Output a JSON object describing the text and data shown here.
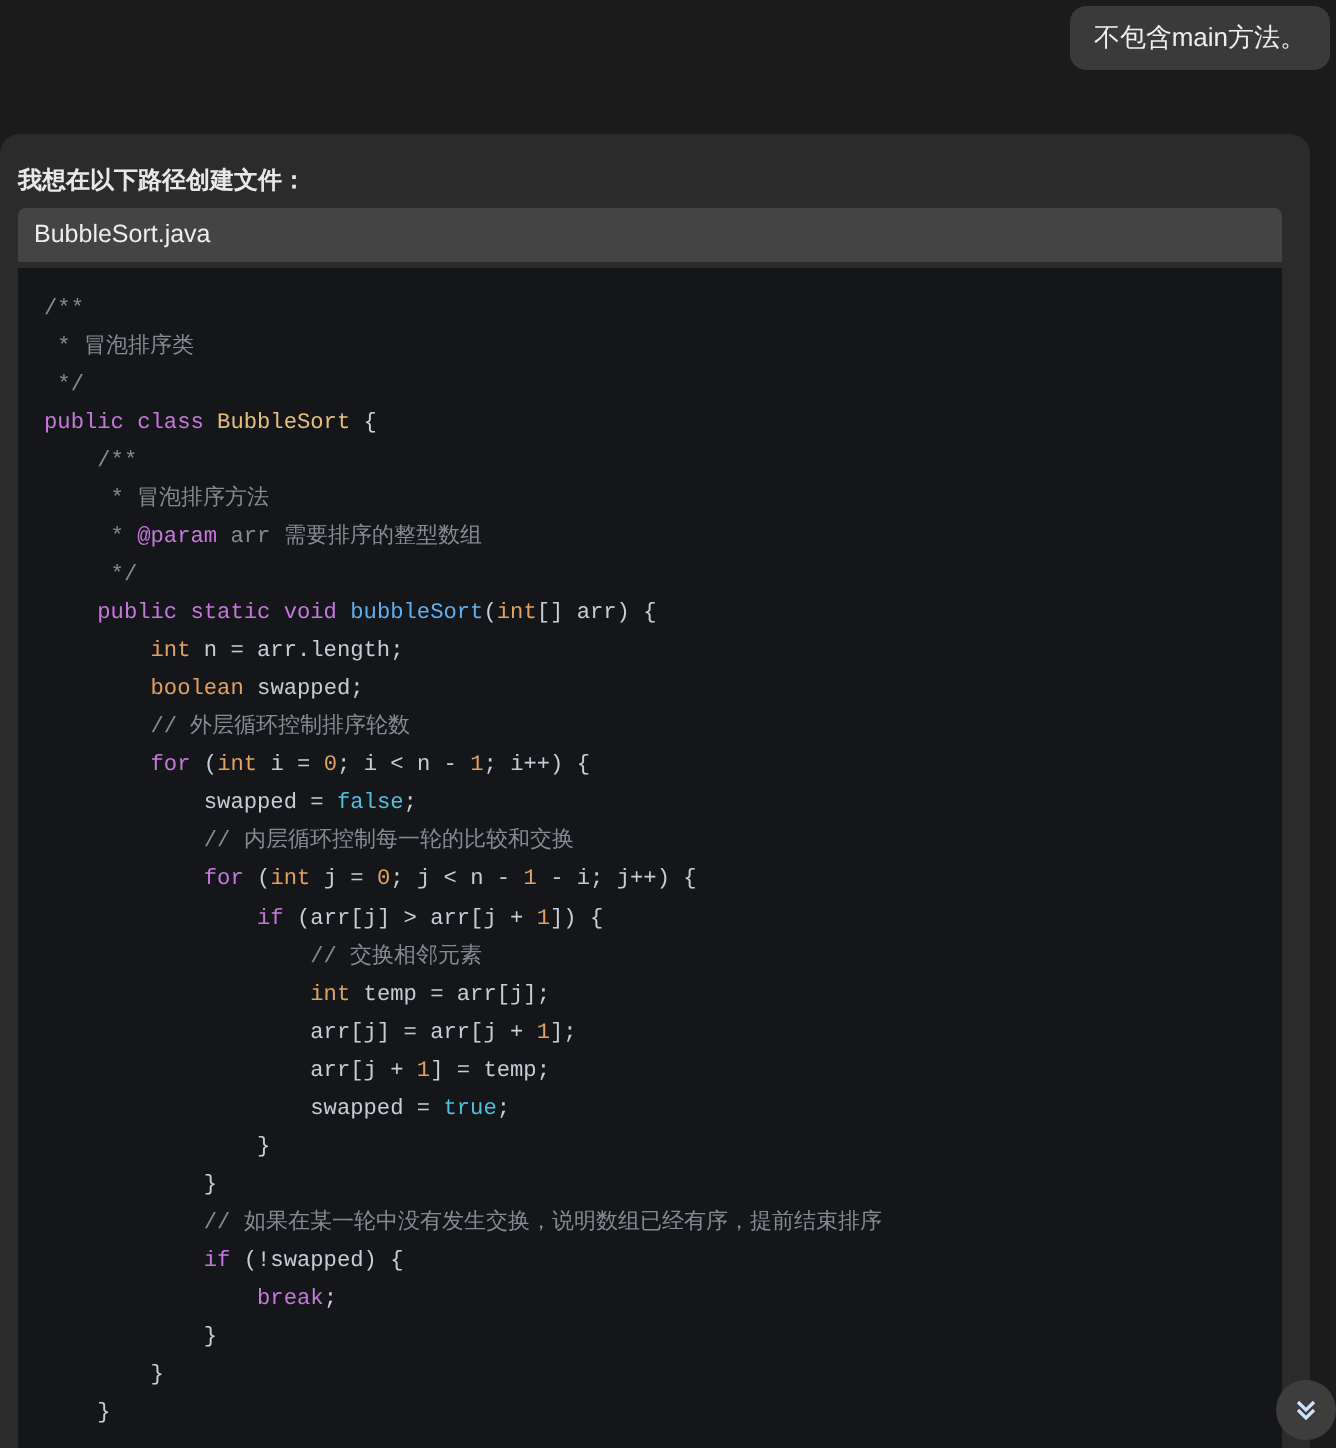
{
  "user_message": {
    "text": "不包含main方法。"
  },
  "assistant": {
    "intro": "我想在以下路径创建文件：",
    "file_path": "BubbleSort.java",
    "code_lines": [
      [
        {
          "kind": "comment",
          "text": "/**"
        }
      ],
      [
        {
          "kind": "comment",
          "text": " * 冒泡排序类"
        }
      ],
      [
        {
          "kind": "comment",
          "text": " */"
        }
      ],
      [
        {
          "kind": "keyword",
          "text": "public class "
        },
        {
          "kind": "class",
          "text": "BubbleSort"
        },
        {
          "kind": "plain",
          "text": " {"
        }
      ],
      [
        {
          "kind": "comment",
          "text": "    /**"
        }
      ],
      [
        {
          "kind": "comment",
          "text": "     * 冒泡排序方法"
        }
      ],
      [
        {
          "kind": "comment",
          "text": "     * "
        },
        {
          "kind": "keyword",
          "text": "@param"
        },
        {
          "kind": "comment",
          "text": " arr 需要排序的整型数组"
        }
      ],
      [
        {
          "kind": "comment",
          "text": "     */"
        }
      ],
      [
        {
          "kind": "keyword",
          "text": "    public static void "
        },
        {
          "kind": "function",
          "text": "bubbleSort"
        },
        {
          "kind": "plain",
          "text": "("
        },
        {
          "kind": "type",
          "text": "int"
        },
        {
          "kind": "plain",
          "text": "[] arr) {"
        }
      ],
      [
        {
          "kind": "type",
          "text": "        int"
        },
        {
          "kind": "plain",
          "text": " n = arr.length;"
        }
      ],
      [
        {
          "kind": "type",
          "text": "        boolean"
        },
        {
          "kind": "plain",
          "text": " swapped;"
        }
      ],
      [
        {
          "kind": "comment",
          "text": "        // 外层循环控制排序轮数"
        }
      ],
      [
        {
          "kind": "keyword",
          "text": "        for"
        },
        {
          "kind": "plain",
          "text": " ("
        },
        {
          "kind": "type",
          "text": "int"
        },
        {
          "kind": "plain",
          "text": " i = "
        },
        {
          "kind": "number",
          "text": "0"
        },
        {
          "kind": "plain",
          "text": "; i < n - "
        },
        {
          "kind": "number",
          "text": "1"
        },
        {
          "kind": "plain",
          "text": "; i++) {"
        }
      ],
      [
        {
          "kind": "plain",
          "text": "            swapped = "
        },
        {
          "kind": "literal",
          "text": "false"
        },
        {
          "kind": "plain",
          "text": ";"
        }
      ],
      [
        {
          "kind": "comment",
          "text": "            // 内层循环控制每一轮的比较和交换"
        }
      ],
      [
        {
          "kind": "keyword",
          "text": "            for"
        },
        {
          "kind": "plain",
          "text": " ("
        },
        {
          "kind": "type",
          "text": "int"
        },
        {
          "kind": "plain",
          "text": " j = "
        },
        {
          "kind": "number",
          "text": "0"
        },
        {
          "kind": "plain",
          "text": "; j < n - "
        },
        {
          "kind": "number",
          "text": "1"
        },
        {
          "kind": "plain",
          "text": " - i; j++) {"
        }
      ],
      [
        {
          "kind": "keyword",
          "text": "                if"
        },
        {
          "kind": "plain",
          "text": " (arr[j] > arr[j + "
        },
        {
          "kind": "number",
          "text": "1"
        },
        {
          "kind": "plain",
          "text": "]) {"
        }
      ],
      [
        {
          "kind": "comment",
          "text": "                    // 交换相邻元素"
        }
      ],
      [
        {
          "kind": "type",
          "text": "                    int"
        },
        {
          "kind": "plain",
          "text": " temp = arr[j];"
        }
      ],
      [
        {
          "kind": "plain",
          "text": "                    arr[j] = arr[j + "
        },
        {
          "kind": "number",
          "text": "1"
        },
        {
          "kind": "plain",
          "text": "];"
        }
      ],
      [
        {
          "kind": "plain",
          "text": "                    arr[j + "
        },
        {
          "kind": "number",
          "text": "1"
        },
        {
          "kind": "plain",
          "text": "] = temp;"
        }
      ],
      [
        {
          "kind": "plain",
          "text": "                    swapped = "
        },
        {
          "kind": "literal",
          "text": "true"
        },
        {
          "kind": "plain",
          "text": ";"
        }
      ],
      [
        {
          "kind": "plain",
          "text": "                }"
        }
      ],
      [
        {
          "kind": "plain",
          "text": "            }"
        }
      ],
      [
        {
          "kind": "comment",
          "text": "            // 如果在某一轮中没有发生交换，说明数组已经有序，提前结束排序"
        }
      ],
      [
        {
          "kind": "keyword",
          "text": "            if"
        },
        {
          "kind": "plain",
          "text": " (!swapped) {"
        }
      ],
      [
        {
          "kind": "keyword",
          "text": "                break"
        },
        {
          "kind": "plain",
          "text": ";"
        }
      ],
      [
        {
          "kind": "plain",
          "text": "            }"
        }
      ],
      [
        {
          "kind": "plain",
          "text": "        }"
        }
      ],
      [
        {
          "kind": "plain",
          "text": "    }"
        }
      ]
    ]
  }
}
